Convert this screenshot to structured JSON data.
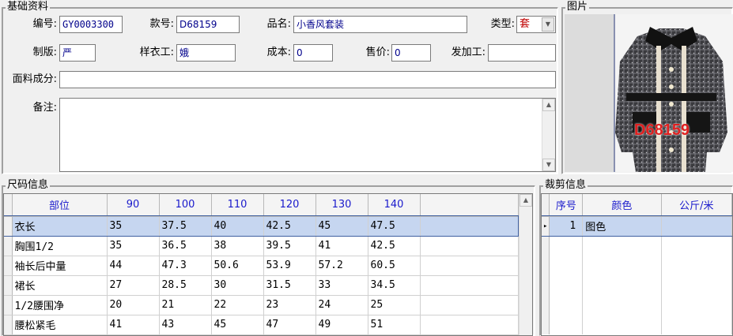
{
  "basic": {
    "title": "基础资料",
    "labels": {
      "code": "编号:",
      "style_no": "款号:",
      "product_name": "品名:",
      "type": "类型:",
      "pattern": "制版:",
      "sample_worker": "样衣工:",
      "cost": "成本:",
      "price": "售价:",
      "processor": "发加工:",
      "fabric": "面料成分:",
      "remark": "备注:"
    },
    "values": {
      "code": "GY0003300",
      "style_no": "D68159",
      "product_name": "小香风套装",
      "type": "套",
      "pattern": "严",
      "sample_worker": "娥",
      "cost": "0",
      "price": "0",
      "processor": "",
      "fabric": "",
      "remark": ""
    }
  },
  "picture": {
    "title": "图片",
    "overlay_text": "D68159"
  },
  "size_info": {
    "title": "尺码信息",
    "columns": [
      "部位",
      "90",
      "100",
      "110",
      "120",
      "130",
      "140"
    ],
    "rows": [
      [
        "衣长",
        "35",
        "37.5",
        "40",
        "42.5",
        "45",
        "47.5"
      ],
      [
        "胸围1/2",
        "35",
        "36.5",
        "38",
        "39.5",
        "41",
        "42.5"
      ],
      [
        "袖长后中量",
        "44",
        "47.3",
        "50.6",
        "53.9",
        "57.2",
        "60.5"
      ],
      [
        "裙长",
        "27",
        "28.5",
        "30",
        "31.5",
        "33",
        "34.5"
      ],
      [
        "1/2腰围净",
        "20",
        "21",
        "22",
        "23",
        "24",
        "25"
      ],
      [
        "腰松紧毛",
        "41",
        "43",
        "45",
        "47",
        "49",
        "51"
      ]
    ],
    "selected_row": 0
  },
  "cut_info": {
    "title": "裁剪信息",
    "columns": [
      "序号",
      "颜色",
      "公斤/米"
    ],
    "rows": [
      [
        "1",
        "图色",
        ""
      ]
    ],
    "selected_row": 0
  }
}
